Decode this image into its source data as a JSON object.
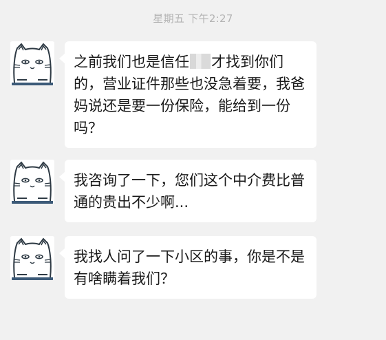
{
  "timestamp": "星期五 下午2:27",
  "messages": [
    {
      "avatar_icon": "cat-face-avatar-icon",
      "text_lines": [
        "之前我们也是信任",
        "才找到你们",
        "的，营业证件那些也没急着要，我爸",
        "妈说还是要一份保险，能给到一份",
        "吗？"
      ]
    },
    {
      "avatar_icon": "cat-face-avatar-icon",
      "text_lines": [
        "我咨询了一下，您们这个中介费比普",
        "通的贵出不少啊..."
      ]
    },
    {
      "avatar_icon": "cat-face-avatar-icon",
      "text_lines": [
        "我找人问了一下小区的事，你是不是",
        "有啥瞒着我们？"
      ]
    }
  ],
  "colors": {
    "background": "#f1f1f1",
    "bubble": "#ffffff",
    "timestamp": "#b3b3b3",
    "text": "#1a1a1a"
  }
}
